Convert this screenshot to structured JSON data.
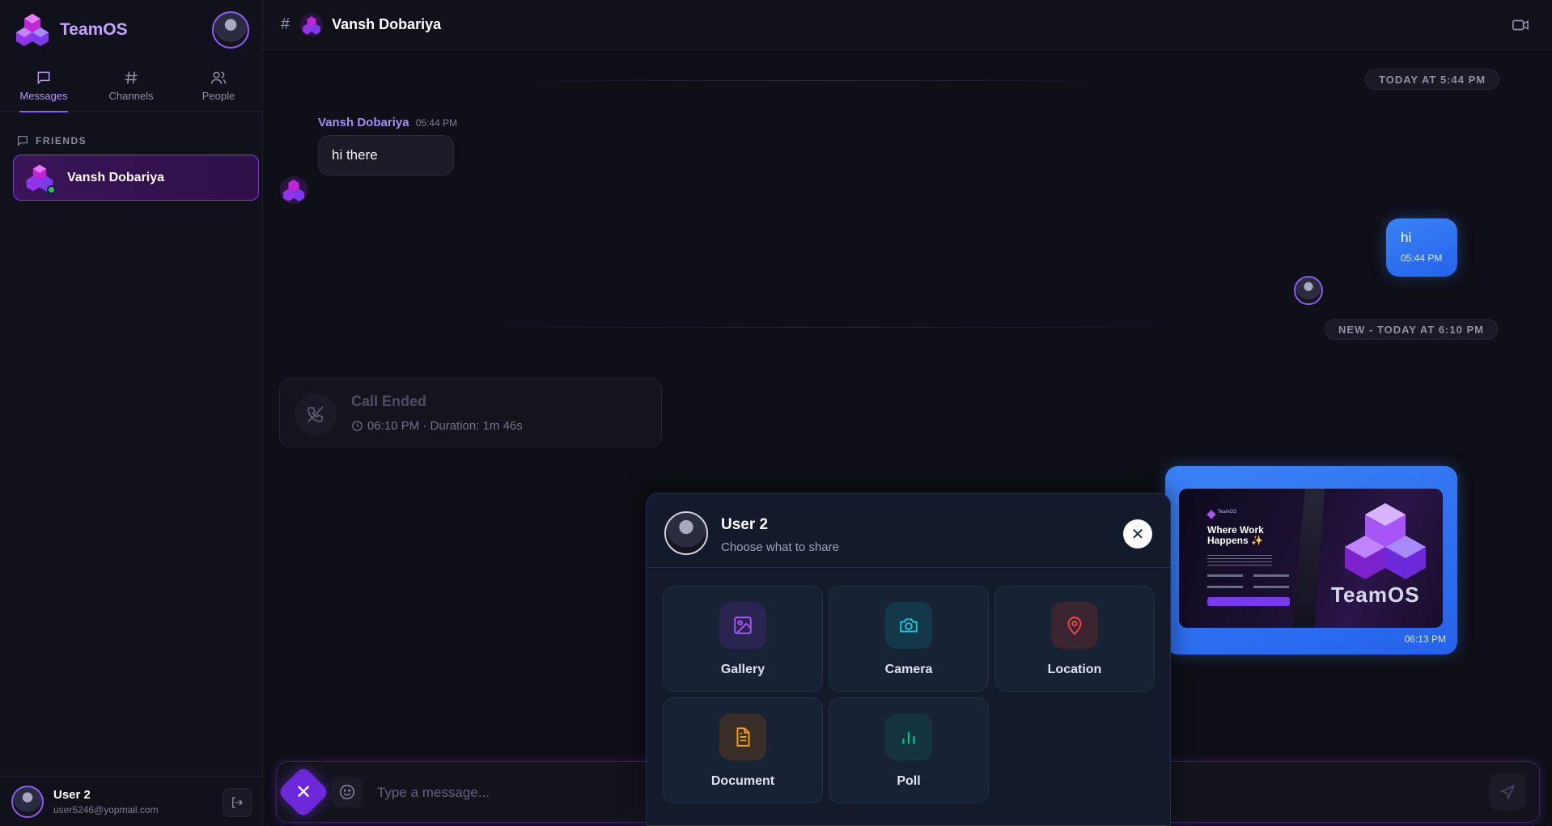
{
  "app": {
    "name": "TeamOS"
  },
  "nav": {
    "tabs": [
      {
        "label": "Messages",
        "icon": "message-icon",
        "active": true
      },
      {
        "label": "Channels",
        "icon": "hash-icon",
        "active": false
      },
      {
        "label": "People",
        "icon": "people-icon",
        "active": false
      }
    ]
  },
  "sidebar": {
    "section_label": "FRIENDS",
    "friends": [
      {
        "name": "Vansh Dobariya",
        "status": "online"
      }
    ]
  },
  "me": {
    "name": "User 2",
    "email": "user5246@yopmail.com"
  },
  "header": {
    "prefix": "#",
    "title": "Vansh Dobariya"
  },
  "chat": {
    "date_label_1": "TODAY AT 5:44 PM",
    "date_label_2": "NEW - TODAY AT 6:10 PM",
    "incoming": {
      "sender": "Vansh Dobariya",
      "time": "05:44 PM",
      "text": "hi there"
    },
    "outgoing": {
      "text": "hi",
      "time": "05:44 PM"
    },
    "call": {
      "title": "Call Ended",
      "detail": "06:10 PM · Duration: 1m 46s"
    },
    "image_message": {
      "time": "06:13 PM",
      "preview_title": "Where Work Happens ✨",
      "preview_brand": "TeamOS",
      "preview_brand_small": "TeamOS"
    }
  },
  "composer": {
    "placeholder": "Type a message...",
    "close_label": "✕"
  },
  "share_panel": {
    "user_name": "User 2",
    "subtitle": "Choose what to share",
    "close_label": "✕",
    "options": [
      {
        "label": "Gallery",
        "icon": "image-icon",
        "color": "#a855f7",
        "bg": "#2a2450"
      },
      {
        "label": "Camera",
        "icon": "camera-icon",
        "color": "#22c3d6",
        "bg": "#13384a"
      },
      {
        "label": "Location",
        "icon": "map-pin-icon",
        "color": "#ef4444",
        "bg": "#3a2530"
      },
      {
        "label": "Document",
        "icon": "document-icon",
        "color": "#f59e0b",
        "bg": "#3a2f28"
      },
      {
        "label": "Poll",
        "icon": "bar-chart-icon",
        "color": "#10b981",
        "bg": "#143540"
      }
    ]
  },
  "colors": {
    "accent": "#8b5cf6",
    "bubble_out": "#2563eb",
    "online": "#22c55e"
  }
}
